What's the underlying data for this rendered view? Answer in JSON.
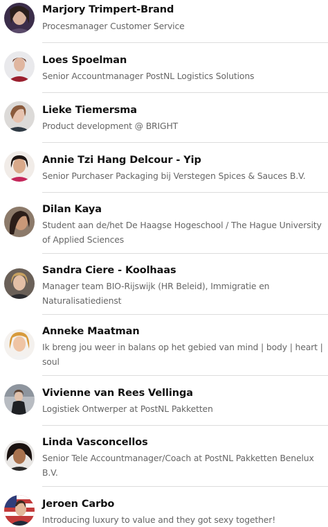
{
  "connections": [
    {
      "name": "Marjory Trimpert-Brand",
      "headline": "Procesmanager Customer Service",
      "avatar_icon": "profile-photo-icon"
    },
    {
      "name": "Loes Spoelman",
      "headline": "Senior Accountmanager PostNL Logistics Solutions",
      "avatar_icon": "profile-photo-icon"
    },
    {
      "name": "Lieke Tiemersma",
      "headline": "Product development @ BRIGHT",
      "avatar_icon": "profile-photo-icon"
    },
    {
      "name": "Annie Tzi Hang Delcour - Yip",
      "headline": "Senior Purchaser Packaging bij Verstegen Spices & Sauces B.V.",
      "avatar_icon": "profile-photo-icon"
    },
    {
      "name": "Dilan Kaya",
      "headline": "Student aan de/het De Haagse Hogeschool / The Hague University of Applied Sciences",
      "avatar_icon": "profile-photo-icon"
    },
    {
      "name": "Sandra Ciere - Koolhaas",
      "headline": "Manager team BIO-Rijswijk (HR Beleid), Immigratie en Naturalisatiedienst",
      "avatar_icon": "profile-photo-icon"
    },
    {
      "name": "Anneke Maatman",
      "headline": "Ik breng jou weer in balans op het gebied van mind | body | heart | soul",
      "avatar_icon": "profile-photo-icon"
    },
    {
      "name": "Vivienne van Rees Vellinga",
      "headline": "Logistiek Ontwerper at PostNL Pakketten",
      "avatar_icon": "profile-photo-icon"
    },
    {
      "name": "Linda Vasconcellos",
      "headline": "Senior Tele Accountmanager/Coach at PostNL Pakketten Benelux B.V.",
      "avatar_icon": "profile-photo-icon"
    },
    {
      "name": "Jeroen Carbo",
      "headline": "Introducing luxury to value and they got sexy together!",
      "avatar_icon": "profile-photo-icon"
    }
  ],
  "colors": {
    "name": "#111111",
    "headline": "#666666",
    "divider": "#dcdcdc"
  }
}
